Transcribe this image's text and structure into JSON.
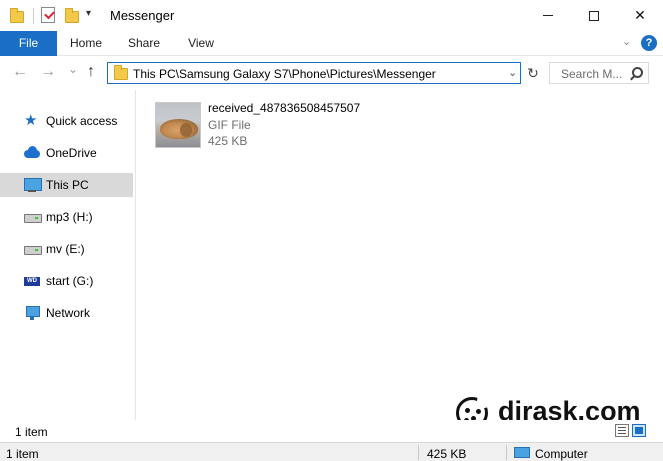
{
  "window": {
    "title": "Messenger",
    "minimize_glyph": "",
    "close_glyph": "✕",
    "qa_dropdown_glyph": "▾"
  },
  "ribbon": {
    "tabs": [
      {
        "label": "File",
        "active": true
      },
      {
        "label": "Home"
      },
      {
        "label": "Share"
      },
      {
        "label": "View"
      }
    ],
    "collapse_glyph": "⌄",
    "help_glyph": "?"
  },
  "addressbar": {
    "back_glyph": "←",
    "forward_glyph": "→",
    "recent_glyph": "⌄",
    "up_glyph": "↑",
    "path": "This PC\\Samsung Galaxy S7\\Phone\\Pictures\\Messenger",
    "dropdown_glyph": "⌄",
    "refresh_glyph": "↻",
    "search_placeholder": "Search M..."
  },
  "navpane": {
    "items": [
      {
        "label": "Quick access",
        "icon": "star-icon"
      },
      {
        "label": "OneDrive",
        "icon": "cloud-icon"
      },
      {
        "label": "This PC",
        "icon": "computer-icon",
        "selected": true
      },
      {
        "label": "mp3 (H:)",
        "icon": "drive-icon"
      },
      {
        "label": "mv (E:)",
        "icon": "drive-icon"
      },
      {
        "label": "start (G:)",
        "icon": "wd-drive-icon"
      },
      {
        "label": "Network",
        "icon": "network-icon"
      }
    ]
  },
  "files": [
    {
      "name": "received_487836508457507",
      "type": "GIF File",
      "size": "425 KB",
      "thumbnail": "puppy-photo"
    }
  ],
  "watermark": {
    "text": "dirask.com"
  },
  "status": {
    "item_count": "1 item",
    "details_item_count": "1 item",
    "details_size": "425 KB",
    "details_location": "Computer"
  },
  "colors": {
    "accent": "#1a6fc4",
    "selection": "#d9d9d9",
    "folder": "#f3c94a"
  }
}
